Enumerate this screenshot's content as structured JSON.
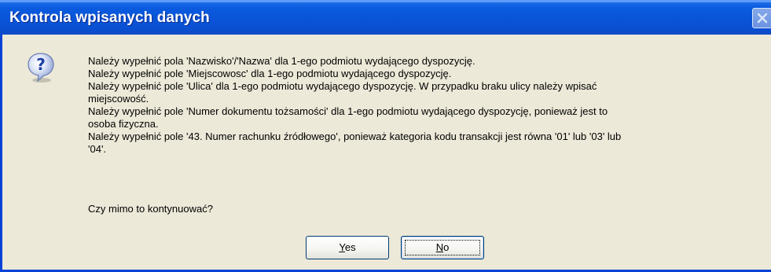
{
  "window": {
    "title": "Kontrola wpisanych danych"
  },
  "icon": {
    "name": "question-icon",
    "glyph": "?"
  },
  "message": {
    "lines": [
      " Należy wypełnić pola 'Nazwisko'/'Nazwa' dla 1-ego podmiotu wydającego dyspozycję.",
      " Należy wypełnić pole 'Miejscowosc' dla 1-ego podmiotu wydającego dyspozycję.",
      " Należy wypełnić pole 'Ulica' dla 1-ego podmiotu wydającego dyspozycję. W przypadku braku ulicy należy wpisać",
      "miejscowość.",
      " Należy wypełnić pole 'Numer dokumentu tożsamości' dla 1-ego podmiotu wydającego dyspozycję, ponieważ jest to",
      "osoba fizyczna.",
      "Należy wypełnić pole '43. Numer rachunku źródłowego', ponieważ kategoria kodu transakcji jest równa '01' lub '03' lub",
      "'04'."
    ],
    "question": "Czy mimo to kontynuować?"
  },
  "buttons": {
    "yes": {
      "accel": "Y",
      "rest": "es"
    },
    "no": {
      "accel": "N",
      "rest": "o"
    }
  },
  "colors": {
    "titlebar": "#0a55d8",
    "dialog_bg": "#ece9d8",
    "button_border": "#003c74"
  }
}
